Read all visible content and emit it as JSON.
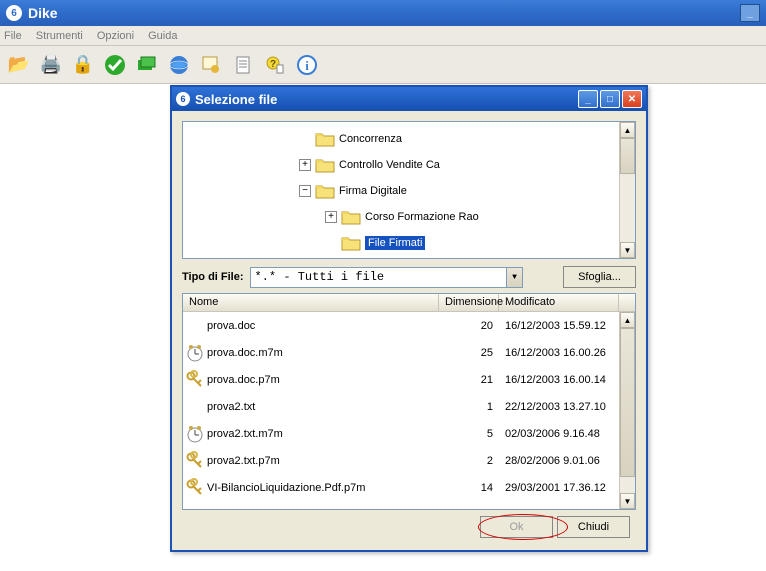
{
  "app": {
    "title": "Dike",
    "menu": [
      "File",
      "Strumenti",
      "Opzioni",
      "Guida"
    ]
  },
  "toolbar_icons": [
    "open-folder",
    "print",
    "lock",
    "check",
    "stack",
    "globe",
    "cert",
    "document",
    "help",
    "info"
  ],
  "dialog": {
    "title": "Selezione file",
    "tree": [
      {
        "indent": 2,
        "expand": "",
        "label": "Concorrenza",
        "selected": false
      },
      {
        "indent": 2,
        "expand": "+",
        "label": "Controllo Vendite Ca",
        "selected": false
      },
      {
        "indent": 2,
        "expand": "−",
        "label": "Firma Digitale",
        "selected": false
      },
      {
        "indent": 3,
        "expand": "+",
        "label": "Corso Formazione Rao",
        "selected": false
      },
      {
        "indent": 3,
        "expand": "",
        "label": "File Firmati",
        "selected": true
      }
    ],
    "type_label": "Tipo di File:",
    "type_value": "*.*  - Tutti i file",
    "browse_label": "Sfoglia...",
    "columns": {
      "name": "Nome",
      "size": "Dimensione",
      "mod": "Modificato"
    },
    "files": [
      {
        "icon": "none",
        "name": "prova.doc",
        "size": "20",
        "mod": "16/12/2003 15.59.12"
      },
      {
        "icon": "clock",
        "name": "prova.doc.m7m",
        "size": "25",
        "mod": "16/12/2003 16.00.26"
      },
      {
        "icon": "keys",
        "name": "prova.doc.p7m",
        "size": "21",
        "mod": "16/12/2003 16.00.14"
      },
      {
        "icon": "none",
        "name": "prova2.txt",
        "size": "1",
        "mod": "22/12/2003 13.27.10"
      },
      {
        "icon": "clock",
        "name": "prova2.txt.m7m",
        "size": "5",
        "mod": "02/03/2006 9.16.48"
      },
      {
        "icon": "keys",
        "name": "prova2.txt.p7m",
        "size": "2",
        "mod": "28/02/2006 9.01.06"
      },
      {
        "icon": "keys",
        "name": "VI-BilancioLiquidazione.Pdf.p7m",
        "size": "14",
        "mod": "29/03/2001 17.36.12"
      }
    ],
    "ok_label": "Ok",
    "close_label": "Chiudi"
  }
}
